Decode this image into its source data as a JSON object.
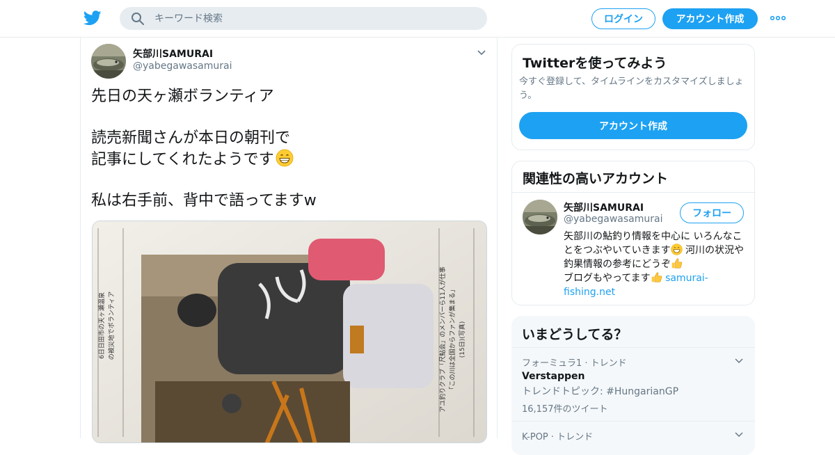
{
  "header": {
    "logo_icon": "twitter-bird-icon",
    "search_placeholder": "キーワード検索",
    "login_label": "ログイン",
    "signup_label": "アカウント作成",
    "more_icon": "more-dots-icon",
    "accent": "#1da1f2"
  },
  "tweet": {
    "author_name": "矢部川SAMURAI",
    "author_handle": "@yabegawasamurai",
    "lines": {
      "l1": "先日の天ヶ瀬ボランティア",
      "l2": "読売新聞さんが本日の朝刊で",
      "l3": "記事にしてくれたようです",
      "l4": "私は右手前、背中で語ってますw"
    },
    "emoji": "grinning-face-icon",
    "newspaper_columns": [
      "6日日田市の天ヶ瀬温泉",
      "の被災地でボランティア",
      "アユ釣りクラブ「尺鮎会」のメンバーら11人が仕事",
      "「この川は全国からファンが集まる」",
      "(15日)(写真)"
    ]
  },
  "try_card": {
    "title": "Twitterを使ってみよう",
    "desc": "今すぐ登録して、タイムラインをカスタマイズしましょう。",
    "cta": "アカウント作成"
  },
  "related": {
    "title": "関連性の高いアカウント",
    "name": "矢部川SAMURAI",
    "handle": "@yabegawasamurai",
    "follow": "フォロー",
    "bio_1": "矢部川の鮎釣り情報を中心に いろんなことをつぶやいていきます",
    "bio_2": " 河川の状況や釣果情報の参考にどうぞ",
    "bio_3": "ブログもやってます",
    "bio_link": "samurai-fishing.net"
  },
  "trends": {
    "title": "いまどうしてる？",
    "items": [
      {
        "meta": "フォーミュラ1 · トレンド",
        "name": "Verstappen",
        "topic": "トレンドトピック: #HungarianGP",
        "count": "16,157件のツイート"
      },
      {
        "meta": "K-POP · トレンド"
      }
    ]
  }
}
